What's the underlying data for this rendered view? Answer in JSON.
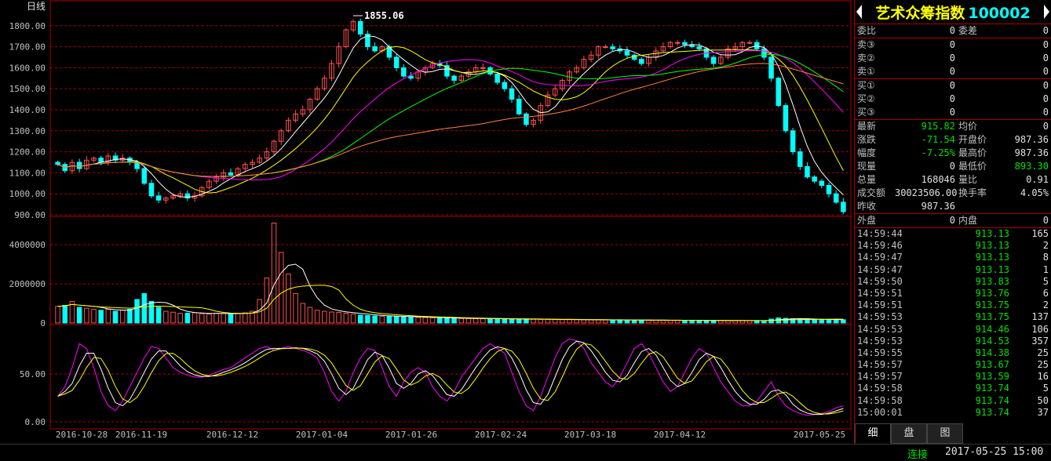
{
  "period_label": "日线",
  "chart_data": {
    "type": "candlestick",
    "price_axis": {
      "ticks": [
        "1800.00",
        "1700.00",
        "1600.00",
        "1500.00",
        "1400.00",
        "1300.00",
        "1200.00",
        "1100.00",
        "1000.00",
        "900.00"
      ],
      "min": 900,
      "max": 1870
    },
    "volume_axis": {
      "ticks": [
        "4000000",
        "2000000",
        "0"
      ],
      "max": 5200000
    },
    "indicator_axis": {
      "ticks": [
        "50.00",
        "0.00"
      ],
      "min": 0,
      "max": 100
    },
    "x_labels": [
      "2016-10-28",
      "2016-11-19",
      "2016-12-12",
      "2017-01-04",
      "2017-01-26",
      "2017-02-24",
      "2017-03-18",
      "2017-04-12",
      "2017-05-25"
    ],
    "peak_label": "1855.06",
    "low_label": "893.3034",
    "closes": [
      1140,
      1110,
      1150,
      1120,
      1160,
      1170,
      1150,
      1180,
      1160,
      1170,
      1150,
      1120,
      1050,
      990,
      970,
      980,
      990,
      1000,
      980,
      990,
      1030,
      1060,
      1080,
      1100,
      1090,
      1120,
      1140,
      1150,
      1170,
      1200,
      1250,
      1300,
      1350,
      1380,
      1400,
      1450,
      1500,
      1550,
      1620,
      1700,
      1780,
      1820,
      1760,
      1700,
      1680,
      1700,
      1650,
      1600,
      1560,
      1550,
      1580,
      1600,
      1620,
      1610,
      1560,
      1540,
      1560,
      1580,
      1600,
      1600,
      1570,
      1530,
      1500,
      1450,
      1380,
      1330,
      1350,
      1420,
      1470,
      1500,
      1540,
      1580,
      1600,
      1640,
      1660,
      1700,
      1700,
      1690,
      1680,
      1660,
      1640,
      1620,
      1650,
      1680,
      1700,
      1720,
      1720,
      1710,
      1700,
      1690,
      1650,
      1620,
      1650,
      1690,
      1700,
      1720,
      1720,
      1690,
      1650,
      1550,
      1420,
      1300,
      1200,
      1130,
      1080,
      1060,
      1040,
      1000,
      960,
      915
    ],
    "volumes": [
      850000,
      900000,
      1100000,
      800000,
      750000,
      700000,
      650000,
      700000,
      600000,
      650000,
      700000,
      1200000,
      1500000,
      1100000,
      800000,
      600000,
      550000,
      500000,
      500000,
      520000,
      480000,
      460000,
      500000,
      480000,
      470000,
      490000,
      520000,
      600000,
      1200000,
      2300000,
      5100000,
      3600000,
      2500000,
      1500000,
      1000000,
      800000,
      650000,
      600000,
      560000,
      540000,
      500000,
      450000,
      400000,
      380000,
      360000,
      350000,
      340000,
      330000,
      320000,
      300000,
      290000,
      280000,
      270000,
      260000,
      250000,
      240000,
      230000,
      230000,
      225000,
      220000,
      215000,
      210000,
      205000,
      200000,
      200000,
      195000,
      190000,
      185000,
      180000,
      180000,
      175000,
      170000,
      170000,
      165000,
      160000,
      160000,
      158000,
      155000,
      150000,
      150000,
      148000,
      145000,
      143000,
      140000,
      140000,
      138000,
      135000,
      135000,
      132000,
      130000,
      130000,
      128000,
      126000,
      125000,
      124000,
      123000,
      122000,
      121000,
      120000,
      200000,
      260000,
      240000,
      220000,
      200000,
      190000,
      180000,
      170000,
      168046,
      168046,
      168046
    ],
    "kdj": [
      30,
      40,
      60,
      85,
      80,
      60,
      35,
      20,
      15,
      25,
      40,
      55,
      70,
      82,
      80,
      70,
      60,
      55,
      52,
      50,
      50,
      52,
      55,
      58,
      60,
      65,
      70,
      75,
      80,
      82,
      78,
      80,
      82,
      80,
      78,
      75,
      70,
      55,
      35,
      25,
      35,
      55,
      70,
      80,
      78,
      60,
      40,
      30,
      45,
      55,
      60,
      55,
      40,
      30,
      25,
      35,
      50,
      60,
      70,
      80,
      85,
      80,
      75,
      55,
      35,
      20,
      15,
      30,
      50,
      70,
      85,
      90,
      88,
      80,
      65,
      55,
      45,
      40,
      50,
      65,
      80,
      85,
      75,
      60,
      45,
      35,
      40,
      55,
      70,
      80,
      75,
      60,
      45,
      35,
      25,
      20,
      20,
      25,
      35,
      45,
      30,
      20,
      15,
      12,
      10,
      11,
      12,
      14,
      18,
      20
    ]
  },
  "quote": {
    "title_name": "艺术众筹指数",
    "title_code": "100002",
    "order_ratio_label": "委比",
    "order_ratio": "0",
    "order_diff_label": "委差",
    "order_diff": "0",
    "asks": [
      {
        "label": "卖③",
        "price": "0",
        "vol": "0"
      },
      {
        "label": "卖②",
        "price": "0",
        "vol": "0"
      },
      {
        "label": "卖①",
        "price": "0",
        "vol": "0"
      }
    ],
    "bids": [
      {
        "label": "买①",
        "price": "0",
        "vol": "0"
      },
      {
        "label": "买②",
        "price": "0",
        "vol": "0"
      },
      {
        "label": "买③",
        "price": "0",
        "vol": "0"
      }
    ],
    "last_label": "最新",
    "last": "915.82",
    "avg_label": "均价",
    "avg": "0",
    "chg_label": "涨跌",
    "chg": "-71.54",
    "open_label": "开盘价",
    "open": "987.36",
    "pct_label": "幅度",
    "pct": "-7.25%",
    "high_label": "最高价",
    "high": "987.36",
    "curvol_label": "现量",
    "curvol": "0",
    "low_label": "最低价",
    "low": "893.30",
    "totvol_label": "总量",
    "totvol": "168046",
    "volratio_label": "量比",
    "volratio": "0.91",
    "amount_label": "成交额",
    "amount": "30023506.00",
    "turnover_label": "换手率",
    "turnover": "4.05%",
    "prevclose_label": "昨收",
    "prevclose": "987.36",
    "outer_label": "外盘",
    "outer": "0",
    "inner_label": "内盘",
    "inner": "0"
  },
  "ticks": [
    {
      "time": "14:59:44",
      "price": "913.13",
      "vol": "165"
    },
    {
      "time": "14:59:46",
      "price": "913.13",
      "vol": "2"
    },
    {
      "time": "14:59:47",
      "price": "913.13",
      "vol": "8"
    },
    {
      "time": "14:59:47",
      "price": "913.13",
      "vol": "1"
    },
    {
      "time": "14:59:50",
      "price": "913.83",
      "vol": "5"
    },
    {
      "time": "14:59:51",
      "price": "913.76",
      "vol": "6"
    },
    {
      "time": "14:59:51",
      "price": "913.75",
      "vol": "2"
    },
    {
      "time": "14:59:53",
      "price": "913.75",
      "vol": "137"
    },
    {
      "time": "14:59:53",
      "price": "914.46",
      "vol": "106"
    },
    {
      "time": "14:59:53",
      "price": "914.53",
      "vol": "357"
    },
    {
      "time": "14:59:55",
      "price": "914.38",
      "vol": "25"
    },
    {
      "time": "14:59:57",
      "price": "913.67",
      "vol": "25"
    },
    {
      "time": "14:59:57",
      "price": "913.59",
      "vol": "16"
    },
    {
      "time": "14:59:58",
      "price": "913.74",
      "vol": "5"
    },
    {
      "time": "14:59:58",
      "price": "913.74",
      "vol": "50"
    },
    {
      "time": "15:00:01",
      "price": "913.74",
      "vol": "37"
    }
  ],
  "tabs": [
    "细",
    "盘",
    "图"
  ],
  "status": {
    "connection": "连接",
    "datetime": "2017-05-25 15:00"
  }
}
